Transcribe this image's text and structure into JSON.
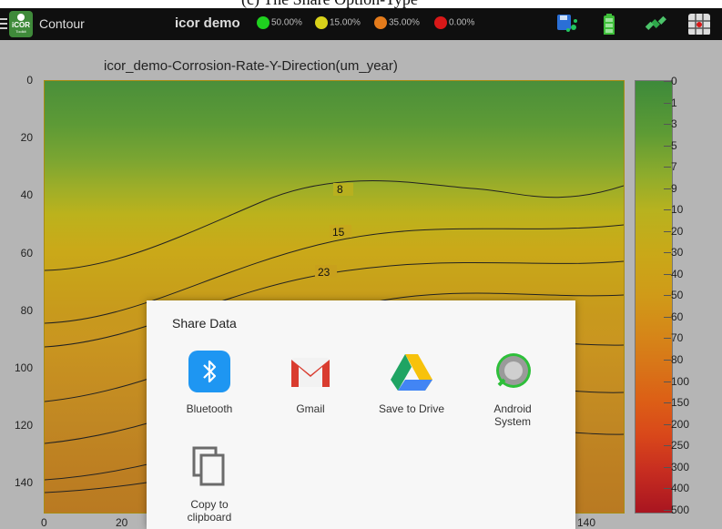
{
  "caption_fragment": "(c) The Share Option-Type",
  "appbar": {
    "app_name": "Contour",
    "logo_text": "iCOR",
    "logo_subtext": "Toolkit",
    "project": "icor demo",
    "status": [
      {
        "color": "#1fd11f",
        "label": "50.00%"
      },
      {
        "color": "#d9d21a",
        "label": "15.00%"
      },
      {
        "color": "#e47b1b",
        "label": "35.00%"
      },
      {
        "color": "#d81818",
        "label": "0.00%"
      }
    ],
    "icons": [
      "save-share-icon",
      "battery-icon",
      "satellite-icon",
      "grid-target-icon"
    ]
  },
  "chart_data": {
    "type": "heatmap",
    "title": "icor_demo-Corrosion-Rate-Y-Direction(um_year)",
    "y_ticks": [
      "0",
      "20",
      "40",
      "60",
      "80",
      "100",
      "120",
      "140"
    ],
    "x_ticks": [
      "0",
      "20",
      "140"
    ],
    "ylim": [
      0,
      150
    ],
    "contour_labels": [
      "8",
      "15",
      "23"
    ],
    "colorbar": {
      "labels": [
        "0",
        "1",
        "3",
        "5",
        "7",
        "9",
        "10",
        "20",
        "30",
        "40",
        "50",
        "60",
        "70",
        "80",
        "100",
        "150",
        "200",
        "250",
        "300",
        "400",
        "500"
      ],
      "low_color": "#3d8a3a",
      "high_color": "#a91520"
    }
  },
  "dialog": {
    "title": "Share Data",
    "items": [
      {
        "label": "Bluetooth",
        "icon": "bluetooth-icon"
      },
      {
        "label": "Gmail",
        "icon": "gmail-icon"
      },
      {
        "label": "Save to Drive",
        "icon": "drive-icon"
      },
      {
        "label": "Android\nSystem",
        "icon": "android-system-icon"
      },
      {
        "label": "Copy to\nclipboard",
        "icon": "copy-icon"
      }
    ]
  }
}
